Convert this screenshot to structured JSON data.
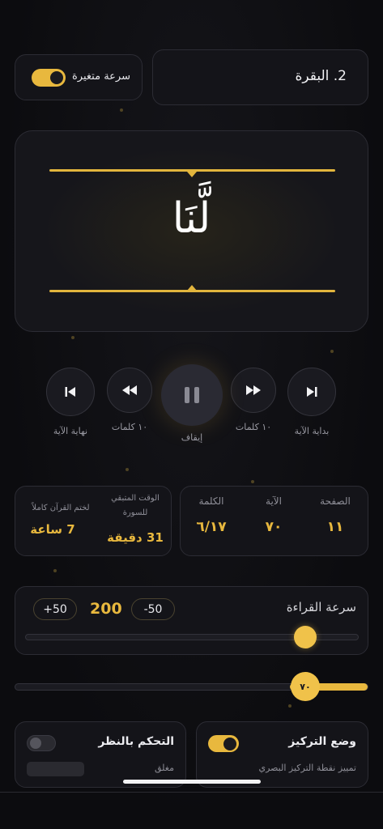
{
  "header": {
    "surah_title": "2. البقرة",
    "variable_speed_label": "سرعة متغيرة"
  },
  "display": {
    "current_word": "لَّنَا"
  },
  "controls": {
    "verse_start_label": "بداية الآية",
    "forward_words_label": "١٠ كلمات",
    "pause_label": "إيقاف",
    "back_words_label": "١٠ كلمات",
    "verse_end_label": "نهاية الآية"
  },
  "stats": {
    "page_label": "الصفحة",
    "page_value": "١١",
    "verse_label": "الآية",
    "verse_value": "٧٠",
    "word_label": "الكلمة",
    "word_value": "٦/١٧",
    "surah_remaining_label_1": "الوقت المتبقي",
    "surah_remaining_label_2": "للسورة",
    "surah_remaining_value": "31 دقيقة",
    "quran_complete_label": "لختم القرآن كاملاً",
    "quran_complete_value": "7 ساعة"
  },
  "speed": {
    "title": "سرعة القراءة",
    "minus_label": "-50",
    "plus_label": "+50",
    "value": "200",
    "slider_fraction": 0.84
  },
  "wpm_slider": {
    "value_label": "٧٠",
    "fraction": 0.78
  },
  "focus_mode": {
    "title": "وضع التركيز",
    "subtitle": "تمييز نقطة التركيز البصري",
    "enabled": true
  },
  "gaze_control": {
    "title": "التحكم بالنظر",
    "status": "مغلق",
    "enabled": false
  },
  "colors": {
    "accent": "#e8b83e",
    "background": "#0c0c0f",
    "card": "#141419"
  }
}
